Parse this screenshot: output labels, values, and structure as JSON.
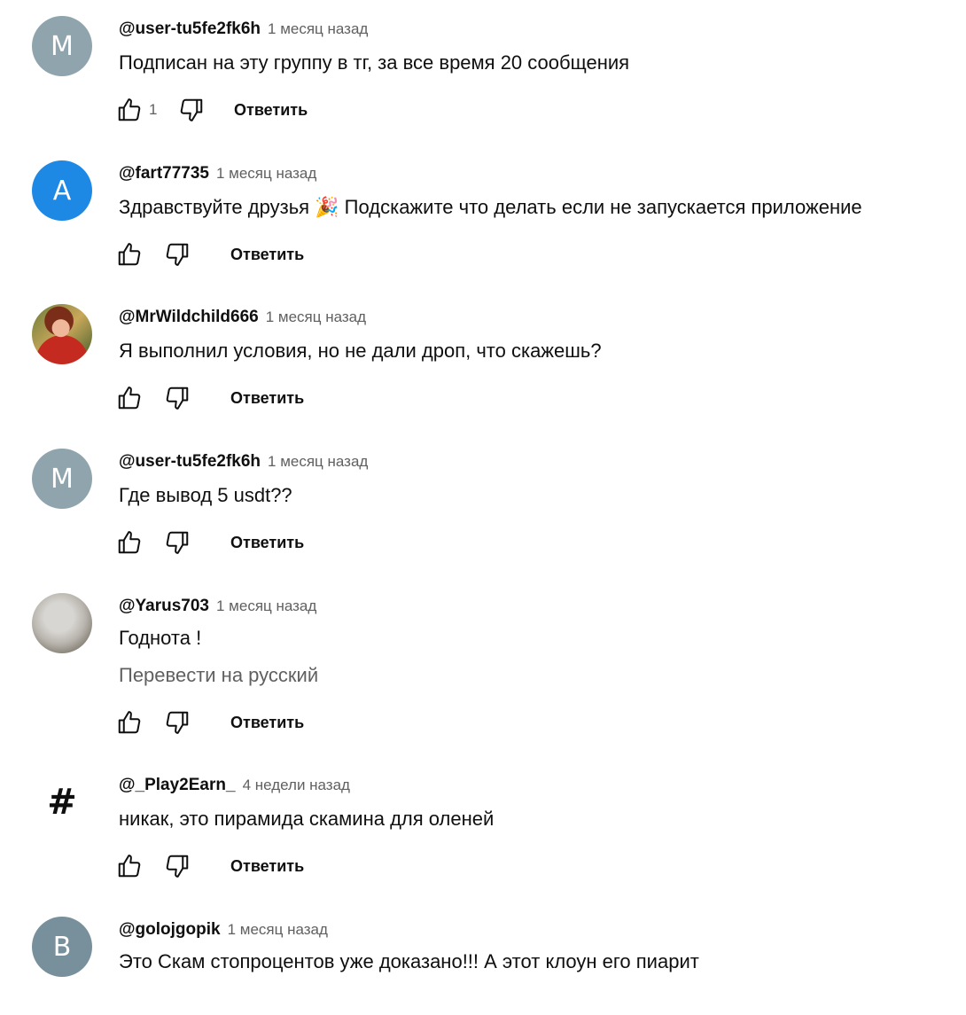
{
  "comments": [
    {
      "avatar": "M",
      "avatar_color": "#90a4ae",
      "author": "@user-tu5fe2fk6h",
      "time": "1 месяц назад",
      "text": "Подписан на эту группу в тг, за все время 20 сообщения",
      "likes": "1",
      "reply": "Ответить"
    },
    {
      "avatar": "A",
      "avatar_color": "#1e88e5",
      "author": "@fart77735",
      "time": "1 месяц назад",
      "text": "Здравствуйте друзья 🎉 Подскажите что делать если не запускается приложение",
      "likes": "",
      "reply": "Ответить"
    },
    {
      "avatar": "",
      "avatar_color": "photo",
      "author": "@MrWildchild666",
      "time": "1 месяц назад",
      "text": "Я выполнил условия, но не дали дроп, что скажешь?",
      "likes": "",
      "reply": "Ответить"
    },
    {
      "avatar": "M",
      "avatar_color": "#90a4ae",
      "author": "@user-tu5fe2fk6h",
      "time": "1 месяц назад",
      "text": "Где вывод 5 usdt??",
      "likes": "",
      "reply": "Ответить"
    },
    {
      "avatar": "",
      "avatar_color": "photo",
      "author": "@Yarus703",
      "time": "1 месяц назад",
      "text": "Годнота !",
      "translate": "Перевести на русский",
      "likes": "",
      "reply": "Ответить"
    },
    {
      "avatar": "#",
      "avatar_color": "transparent",
      "author": "@_Play2Earn_",
      "time": "4 недели назад",
      "text": "никак, это пирамида скамина для оленей",
      "likes": "",
      "reply": "Ответить"
    },
    {
      "avatar": "B",
      "avatar_color": "#78909c",
      "author": "@golojgopik",
      "time": "1 месяц назад",
      "text": "Это Скам стопроцентов уже доказано!!! А этот клоун его пиарит"
    }
  ],
  "icons": [
    "like-icon",
    "dislike-icon"
  ]
}
